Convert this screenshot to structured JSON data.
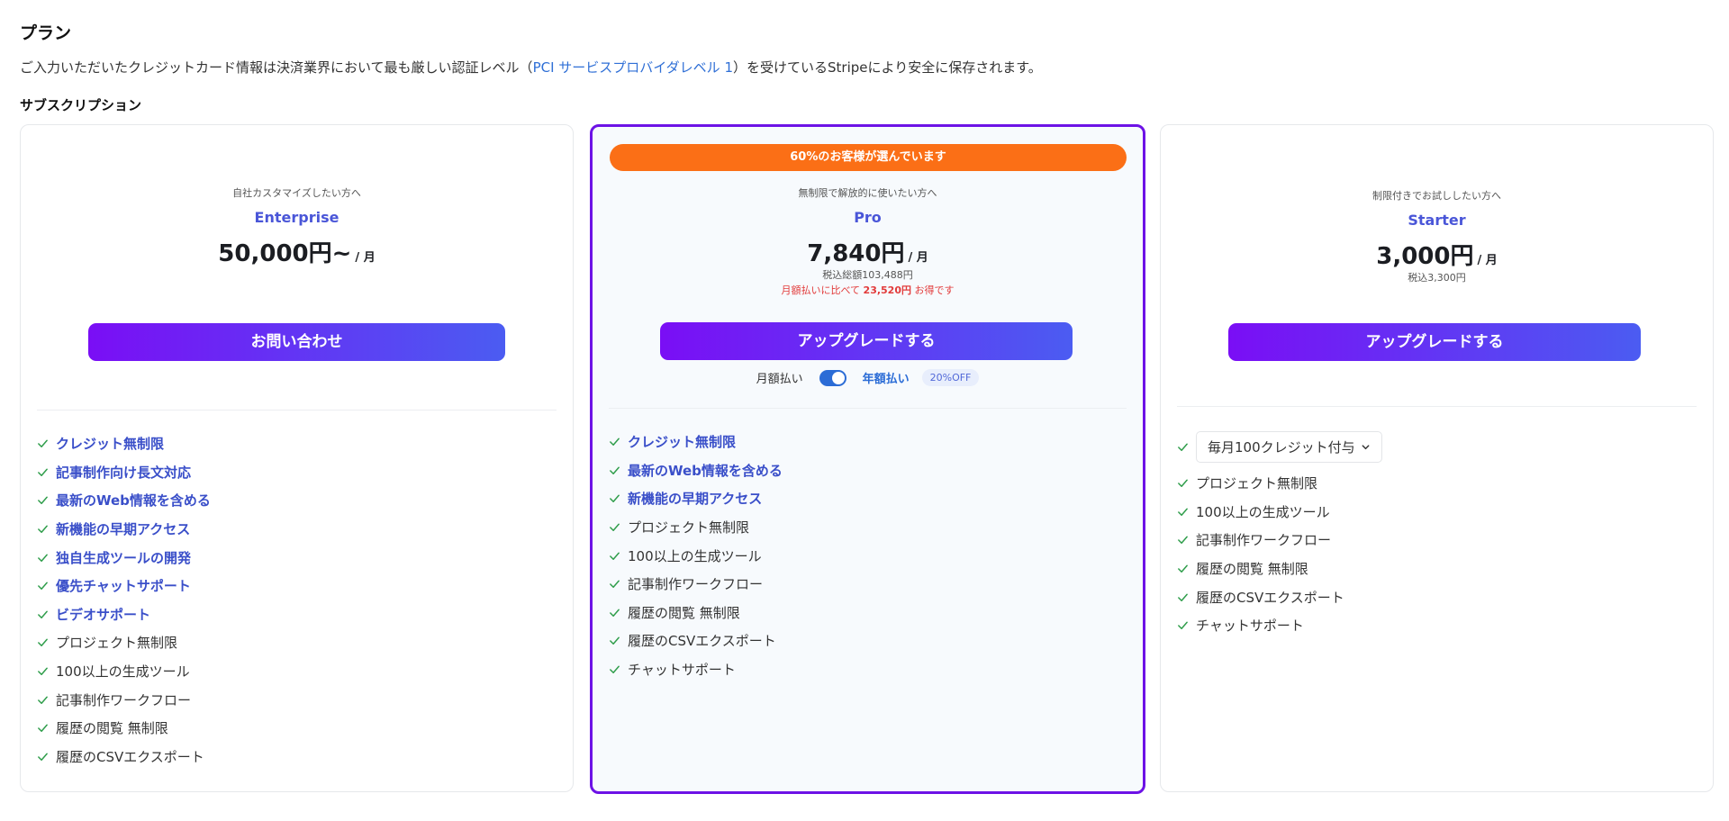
{
  "page": {
    "title": "プラン",
    "notice_prefix": "ご入力いただいたクレジットカード情報は決済業界において最も厳しい認証レベル（",
    "notice_link": "PCI サービスプロバイダレベル 1",
    "notice_suffix": "）を受けているStripeにより安全に保存されます。",
    "section_title": "サブスクリプション"
  },
  "plans": {
    "enterprise": {
      "tagline": "自社カスタマイズしたい方へ",
      "name": "Enterprise",
      "price": "50,000円~",
      "per": "/ 月",
      "cta": "お問い合わせ",
      "features": [
        {
          "label": "クレジット無制限",
          "highlight": true
        },
        {
          "label": "記事制作向け長文対応",
          "highlight": true
        },
        {
          "label": "最新のWeb情報を含める",
          "highlight": true
        },
        {
          "label": "新機能の早期アクセス",
          "highlight": true
        },
        {
          "label": "独自生成ツールの開発",
          "highlight": true
        },
        {
          "label": "優先チャットサポート",
          "highlight": true
        },
        {
          "label": "ビデオサポート",
          "highlight": true
        },
        {
          "label": "プロジェクト無制限",
          "highlight": false
        },
        {
          "label": "100以上の生成ツール",
          "highlight": false
        },
        {
          "label": "記事制作ワークフロー",
          "highlight": false
        },
        {
          "label": "履歴の閲覧 無制限",
          "highlight": false
        },
        {
          "label": "履歴のCSVエクスポート",
          "highlight": false
        }
      ]
    },
    "pro": {
      "badge": "60%のお客様が選んでいます",
      "tagline": "無制限で解放的に使いたい方へ",
      "name": "Pro",
      "price": "7,840円",
      "per": "/ 月",
      "tax": "税込総額103,488円",
      "savings_prefix": "月額払いに比べて",
      "savings_amount": "23,520円",
      "savings_suffix": "お得です",
      "cta": "アップグレードする",
      "billing": {
        "monthly_label": "月額払い",
        "yearly_label": "年額払い",
        "discount_badge": "20%OFF",
        "yearly_selected": true
      },
      "features": [
        {
          "label": "クレジット無制限",
          "highlight": true
        },
        {
          "label": "最新のWeb情報を含める",
          "highlight": true
        },
        {
          "label": "新機能の早期アクセス",
          "highlight": true
        },
        {
          "label": "プロジェクト無制限",
          "highlight": false
        },
        {
          "label": "100以上の生成ツール",
          "highlight": false
        },
        {
          "label": "記事制作ワークフロー",
          "highlight": false
        },
        {
          "label": "履歴の閲覧 無制限",
          "highlight": false
        },
        {
          "label": "履歴のCSVエクスポート",
          "highlight": false
        },
        {
          "label": "チャットサポート",
          "highlight": false
        }
      ]
    },
    "starter": {
      "tagline": "制限付きでお試ししたい方へ",
      "name": "Starter",
      "price": "3,000円",
      "per": "/ 月",
      "tax": "税込3,300円",
      "cta": "アップグレードする",
      "credit_select": "毎月100クレジット付与",
      "features": [
        {
          "label": "プロジェクト無制限",
          "highlight": false
        },
        {
          "label": "100以上の生成ツール",
          "highlight": false
        },
        {
          "label": "記事制作ワークフロー",
          "highlight": false
        },
        {
          "label": "履歴の閲覧 無制限",
          "highlight": false
        },
        {
          "label": "履歴のCSVエクスポート",
          "highlight": false
        },
        {
          "label": "チャットサポート",
          "highlight": false
        }
      ]
    }
  },
  "colors": {
    "accent": "#4a56d8",
    "popular_badge": "#fb6f16",
    "check": "#2e9d4a",
    "savings": "#e23b3b"
  },
  "icons": {
    "feature": "check-icon",
    "dropdown": "chevron-down-icon"
  }
}
